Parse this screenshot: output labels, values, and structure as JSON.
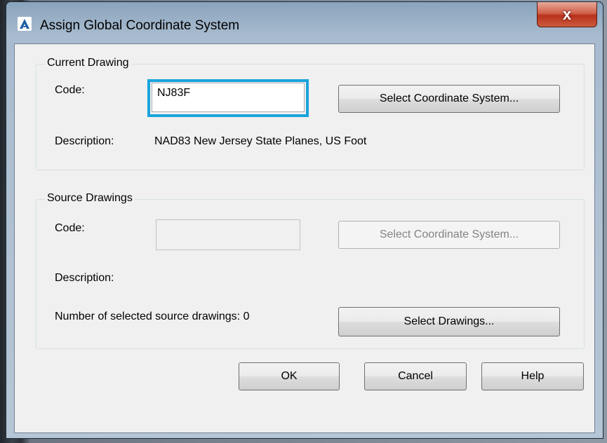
{
  "window": {
    "title": "Assign Global Coordinate System",
    "close_label": "x",
    "accent_close": "#c8452c",
    "highlight_color": "#1aa3dc"
  },
  "current_drawing": {
    "group_label": "Current Drawing",
    "code_label": "Code:",
    "code_value": "NJ83F",
    "select_button": "Select Coordinate System...",
    "description_label": "Description:",
    "description_value": "NAD83 New Jersey State Planes, US Foot"
  },
  "source_drawings": {
    "group_label": "Source Drawings",
    "code_label": "Code:",
    "code_value": "",
    "select_button": "Select Coordinate System...",
    "description_label": "Description:",
    "count_label": "Number of selected source drawings: 0",
    "select_drawings_button": "Select Drawings..."
  },
  "footer": {
    "ok": "OK",
    "cancel": "Cancel",
    "help": "Help"
  },
  "icons": {
    "app": "autocad-logo-icon",
    "close": "close-icon"
  }
}
